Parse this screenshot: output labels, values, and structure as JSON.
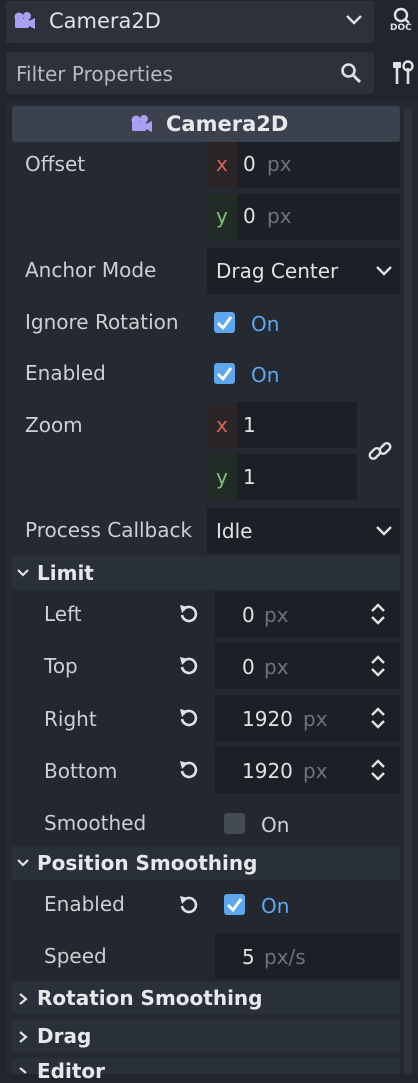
{
  "header": {
    "node_name": "Camera2D",
    "doc_label": "DOC"
  },
  "filter": {
    "placeholder": "Filter Properties"
  },
  "inspector": {
    "title": "Camera2D",
    "offset": {
      "label": "Offset",
      "x": "0",
      "y": "0",
      "unit": "px"
    },
    "anchor_mode": {
      "label": "Anchor Mode",
      "value": "Drag Center"
    },
    "ignore_rotation": {
      "label": "Ignore Rotation",
      "value": "On",
      "checked": true
    },
    "enabled": {
      "label": "Enabled",
      "value": "On",
      "checked": true
    },
    "zoom": {
      "label": "Zoom",
      "x": "1",
      "y": "1"
    },
    "process_callback": {
      "label": "Process Callback",
      "value": "Idle"
    },
    "axis": {
      "x": "x",
      "y": "y"
    }
  },
  "limit": {
    "title": "Limit",
    "left": {
      "label": "Left",
      "value": "0",
      "unit": "px"
    },
    "top": {
      "label": "Top",
      "value": "0",
      "unit": "px"
    },
    "right": {
      "label": "Right",
      "value": "1920",
      "unit": "px"
    },
    "bottom": {
      "label": "Bottom",
      "value": "1920",
      "unit": "px"
    },
    "smoothed": {
      "label": "Smoothed",
      "value": "On",
      "checked": false
    }
  },
  "position_smoothing": {
    "title": "Position Smoothing",
    "enabled": {
      "label": "Enabled",
      "value": "On",
      "checked": true
    },
    "speed": {
      "label": "Speed",
      "value": "5",
      "unit": "px/s"
    }
  },
  "collapsed_sections": [
    "Rotation Smoothing",
    "Drag",
    "Editor"
  ],
  "colors": {
    "accent": "#5fa7ec",
    "x_axis": "#d9675a",
    "y_axis": "#7fc27a"
  }
}
